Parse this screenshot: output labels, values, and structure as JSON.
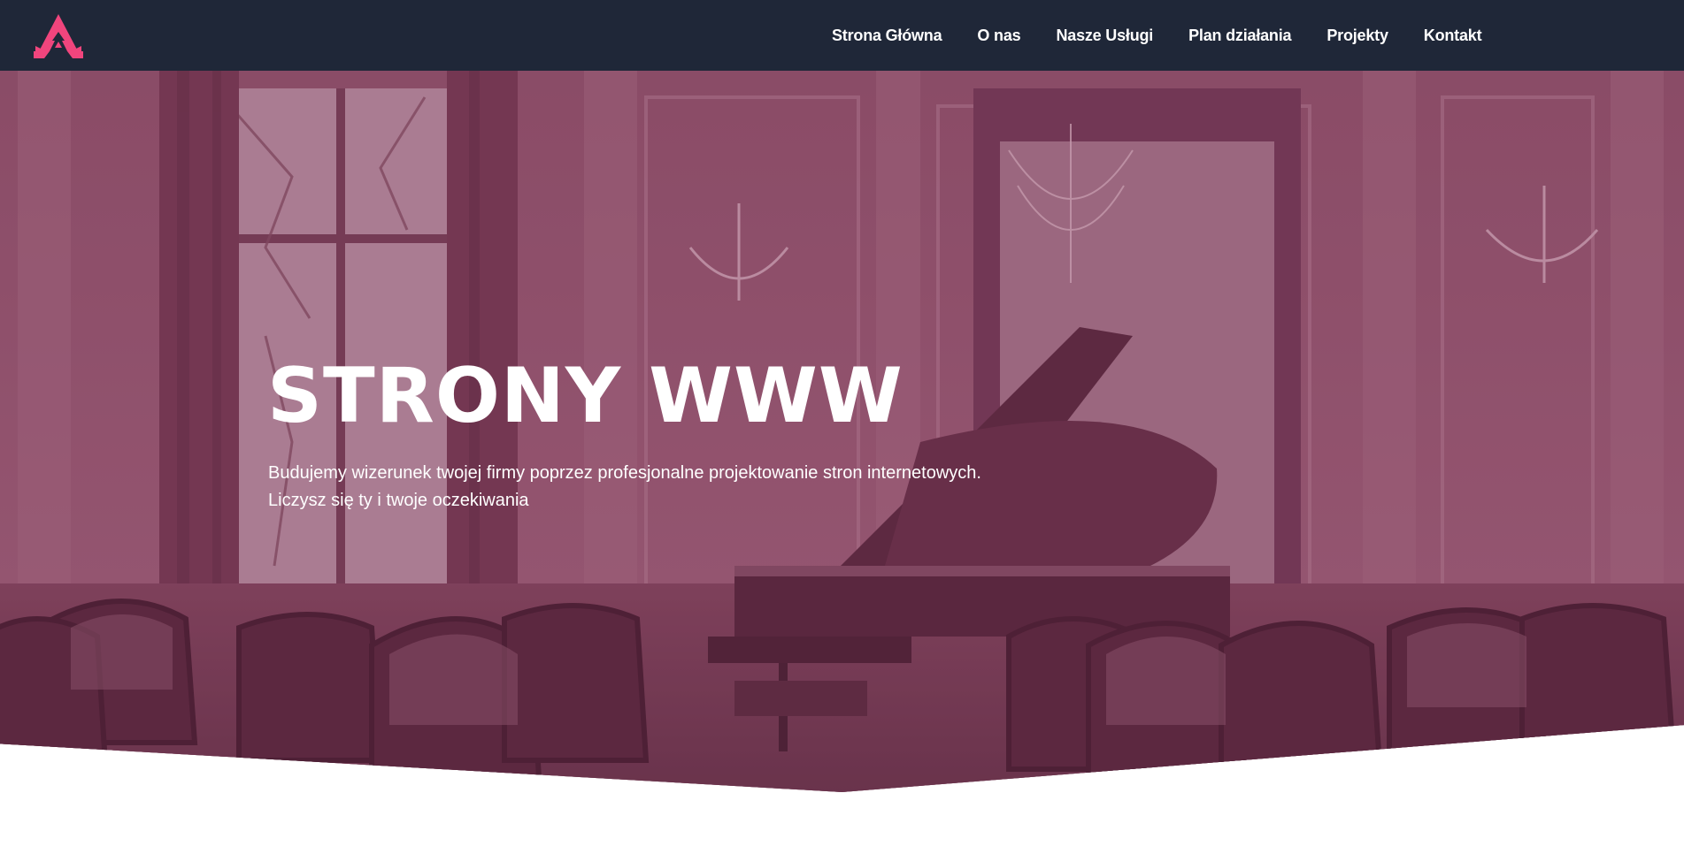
{
  "brand": {
    "logo_icon": "logo-triangle-icon",
    "accent_color": "#f0457d"
  },
  "navbar": {
    "background": "#1f2738",
    "items": [
      {
        "label": "Strona Główna"
      },
      {
        "label": "O nas"
      },
      {
        "label": "Nasze Usługi"
      },
      {
        "label": "Plan działania"
      },
      {
        "label": "Projekty"
      },
      {
        "label": "Kontakt"
      }
    ]
  },
  "hero": {
    "title": "STRONY WWW",
    "lines": [
      "Budujemy wizerunek twojej firmy poprzez profesjonalne projektowanie stron internetowych.",
      "Liczysz się ty i twoje oczekiwania"
    ],
    "overlay_color": "#7b4459"
  }
}
